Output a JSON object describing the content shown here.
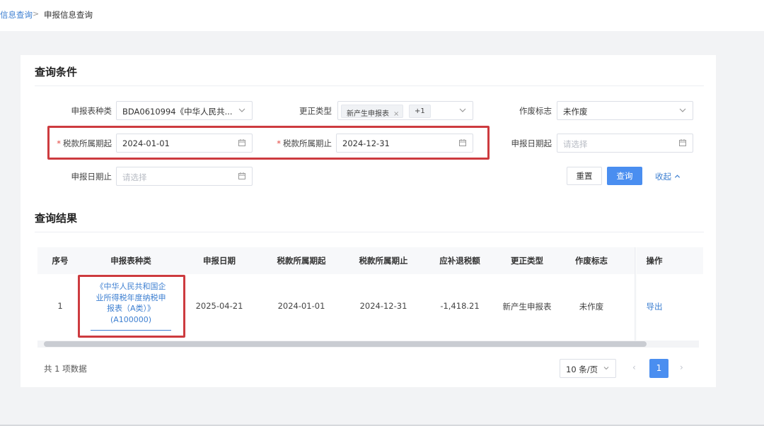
{
  "breadcrumb": {
    "parent": "信息查询",
    "separator": ">",
    "current": "申报信息查询"
  },
  "query": {
    "title": "查询条件",
    "fields": {
      "report_type": {
        "label": "申报表种类",
        "value": "BDA0610994《中华人民共..."
      },
      "correction_type": {
        "label": "更正类型",
        "tag": "新产生申报表",
        "tag_close": "×",
        "extra": "+1"
      },
      "void_flag": {
        "label": "作废标志",
        "value": "未作废"
      },
      "tax_period_start": {
        "required_mark": "*",
        "label": "税款所属期起",
        "value": "2024-01-01"
      },
      "tax_period_end": {
        "required_mark": "*",
        "label": "税款所属期止",
        "value": "2024-12-31"
      },
      "declare_date_start": {
        "label": "申报日期起",
        "placeholder": "请选择"
      },
      "declare_date_end": {
        "label": "申报日期止",
        "placeholder": "请选择"
      }
    },
    "buttons": {
      "reset": "重置",
      "search": "查询",
      "collapse": "收起"
    }
  },
  "results": {
    "title": "查询结果",
    "columns": [
      "序号",
      "申报表种类",
      "申报日期",
      "税款所属期起",
      "税款所属期止",
      "应补退税额",
      "更正类型",
      "作废标志",
      "操作"
    ],
    "rows": [
      {
        "index": "1",
        "report_name_lines": [
          "《中华人民共和国企",
          "业所得税年度纳税申",
          "报表（A类）》",
          "(A100000)"
        ],
        "declare_date": "2025-04-21",
        "period_start": "2024-01-01",
        "period_end": "2024-12-31",
        "tax_amount": "-1,418.21",
        "correction_type": "新产生申报表",
        "void_flag": "未作废",
        "action": "导出"
      }
    ],
    "total_text": "共 1 项数据",
    "page_size": "10 条/页",
    "page_prev": "‹",
    "page_next": "›",
    "current_page": "1"
  },
  "colors": {
    "accent": "#4a8ef0",
    "link": "#3d7fd1",
    "highlight": "#cd3b3f",
    "required": "#e4463f"
  }
}
